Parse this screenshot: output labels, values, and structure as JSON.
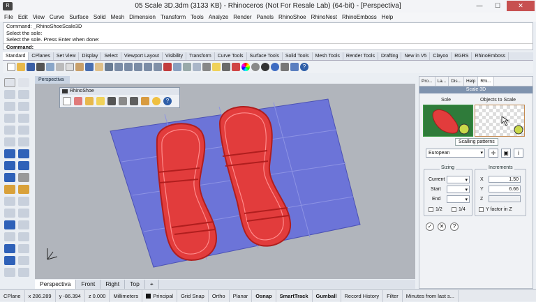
{
  "window": {
    "title": "05 Scale 3D.3dm (3133 KB) - Rhinoceros (Not For Resale Lab) (64-bit) - [Perspectiva]"
  },
  "menu": [
    "File",
    "Edit",
    "View",
    "Curve",
    "Surface",
    "Solid",
    "Mesh",
    "Dimension",
    "Transform",
    "Tools",
    "Analyze",
    "Render",
    "Panels",
    "RhinoShoe",
    "RhinoNest",
    "RhinoEmboss",
    "Help"
  ],
  "command": {
    "lines": [
      "Command: _RhinoShoeScale3D",
      "Select the sole:",
      "Select the sole. Press Enter when done:"
    ],
    "prompt": "Command:"
  },
  "toolbar_tabs": [
    "Standard",
    "CPlanes",
    "Set View",
    "Display",
    "Select",
    "Viewport Layout",
    "Visibility",
    "Transform",
    "Curve Tools",
    "Surface Tools",
    "Solid Tools",
    "Mesh Tools",
    "Render Tools",
    "Drafting",
    "New in V5",
    "Clayoo",
    "RGRS",
    "RhinoEmboss"
  ],
  "viewport": {
    "name": "Perspectiva",
    "tabs": [
      "Perspectiva",
      "Front",
      "Right",
      "Top"
    ],
    "add_symbol": "⌖"
  },
  "floating_toolbar": {
    "title": "RhinoShoe"
  },
  "panel": {
    "tabs": [
      "Pro...",
      "La...",
      "Dis...",
      "Help",
      "Rhi..."
    ],
    "header": "Scale 3D",
    "sole_label": "Sole",
    "objects_label": "Objects to Scale",
    "tooltip": "Scalling patterns",
    "pattern_select": "European",
    "sizing": {
      "title": "Sizing",
      "rows": [
        "Current",
        "Start",
        "End"
      ],
      "half": "1/2",
      "quarter": "1/4"
    },
    "increments": {
      "title": "Increments",
      "x_label": "X",
      "x_value": "1.50",
      "y_label": "Y",
      "y_value": "6.66",
      "z_label": "Z",
      "z_value": "",
      "yfactor": "Y factor in Z"
    }
  },
  "status": {
    "cplane": "CPlane",
    "x": "x 286.289",
    "y": "y -86.394",
    "z": "z 0.000",
    "units": "Millimeters",
    "layer": "Principal",
    "items": [
      "Grid Snap",
      "Ortho",
      "Planar",
      "Osnap",
      "SmartTrack",
      "Gumball",
      "Record History",
      "Filter",
      "Minutes from last s..."
    ],
    "bold_items": [
      "Osnap",
      "SmartTrack",
      "Gumball"
    ]
  },
  "colors": {
    "sole": "#e23c3c",
    "plane": "#6c74d8",
    "background": "#b1b5bc"
  }
}
